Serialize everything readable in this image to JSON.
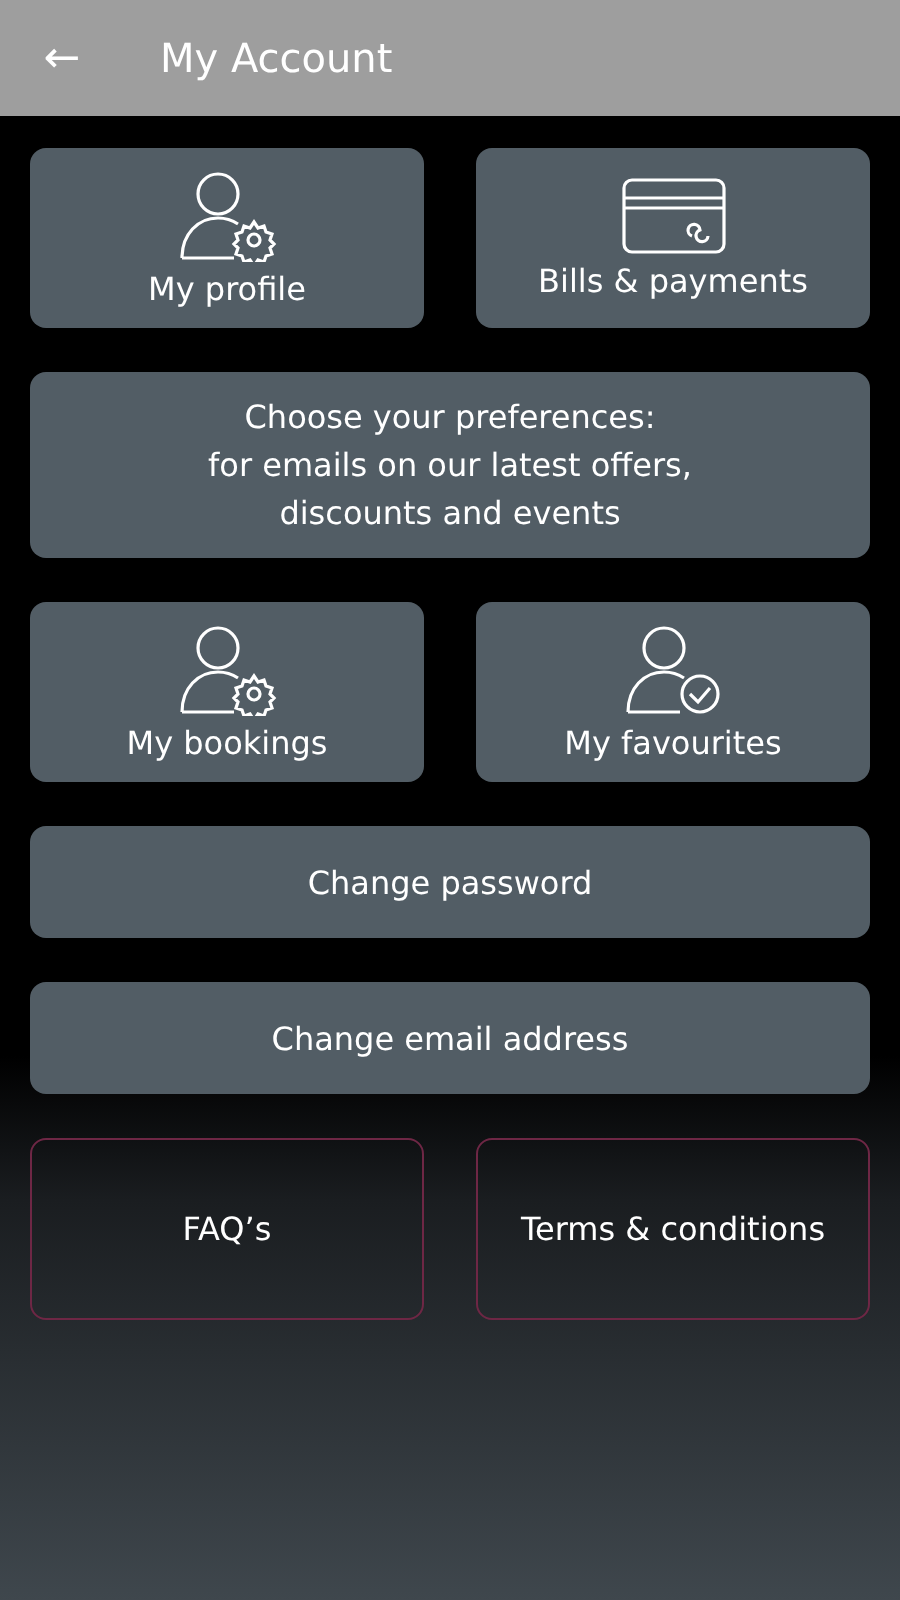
{
  "header": {
    "back": "←",
    "title": "My Account"
  },
  "rows": [
    [
      {
        "kind": "gear_tile",
        "label": "My profile"
      },
      {
        "kind": "card_tile",
        "label": "Bills & payments"
      }
    ],
    [
      {
        "kind": "wide",
        "lines": [
          "Choose your preferences:",
          "for emails on our latest offers,",
          "discounts and events"
        ]
      }
    ],
    [
      {
        "kind": "gear_tile",
        "label": "My bookings"
      },
      {
        "kind": "check_tile",
        "label": "My favourites"
      }
    ],
    [
      {
        "kind": "bar",
        "label": "Change password"
      }
    ],
    [
      {
        "kind": "bar",
        "label": "Change email address"
      }
    ],
    [
      {
        "kind": "outline",
        "label": "FAQ’s"
      },
      {
        "kind": "outline",
        "label": "Terms & conditions"
      }
    ]
  ]
}
